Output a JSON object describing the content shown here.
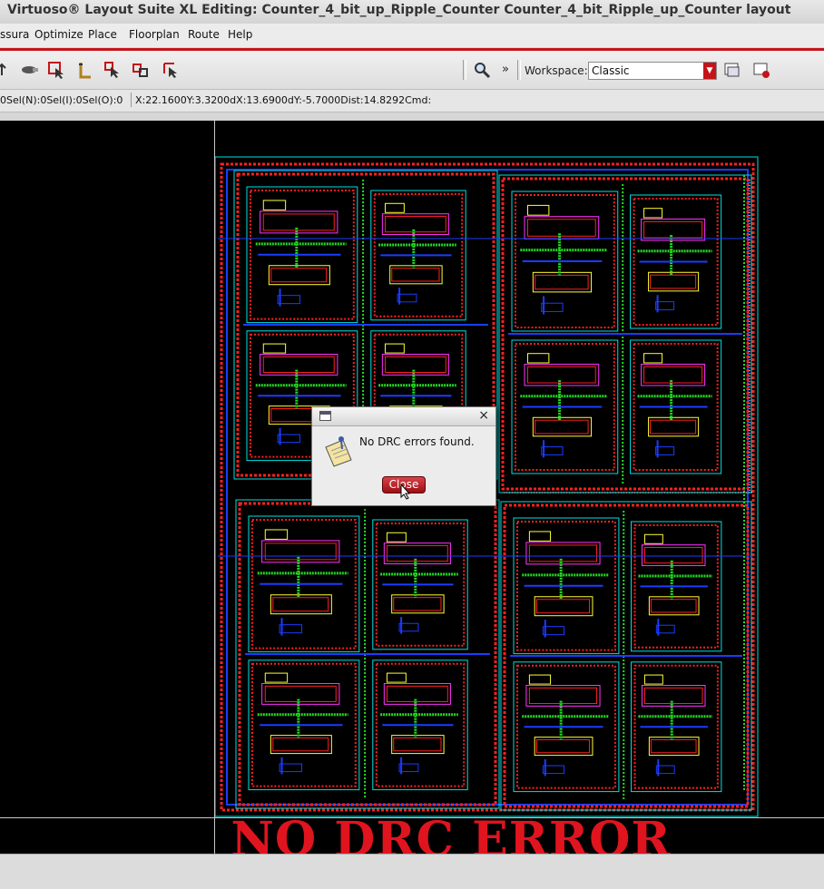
{
  "window": {
    "title": "Virtuoso® Layout Suite XL Editing: Counter_4_bit_up_Ripple_Counter Counter_4_bit_Ripple_up_Counter layout"
  },
  "menu": {
    "items": [
      "ssura",
      "Optimize",
      "Place",
      "Floorplan",
      "Route",
      "Help"
    ]
  },
  "toolbar": {
    "icons": [
      "flip-tool-icon",
      "probe-tool-icon",
      "select-area-icon",
      "ruler-tool-icon",
      "select-pointer-icon",
      "move-tool-icon",
      "stretch-tool-icon",
      "zoom-search-icon"
    ],
    "more_label": "»",
    "workspace_label": "Workspace:",
    "workspace_value": "Classic"
  },
  "status": {
    "selection": "0Sel(N):0Sel(I):0Sel(O):0",
    "coords": "X:22.1600Y:3.3200dX:13.6900dY:-5.7000Dist:14.8292Cmd:"
  },
  "dialog": {
    "message": "No DRC errors found.",
    "button": "Close",
    "close_symbol": "×"
  },
  "banner": {
    "text": "NO DRC ERROR",
    "color": "#e0141e"
  },
  "colors": {
    "accent": "#c4141a",
    "metal1": "#1a3cff",
    "poly": "#ff2020",
    "diffusion": "#22dd22",
    "nwell": "#00e0e0",
    "contact": "#ffff33",
    "metal2": "#ff33ff"
  }
}
